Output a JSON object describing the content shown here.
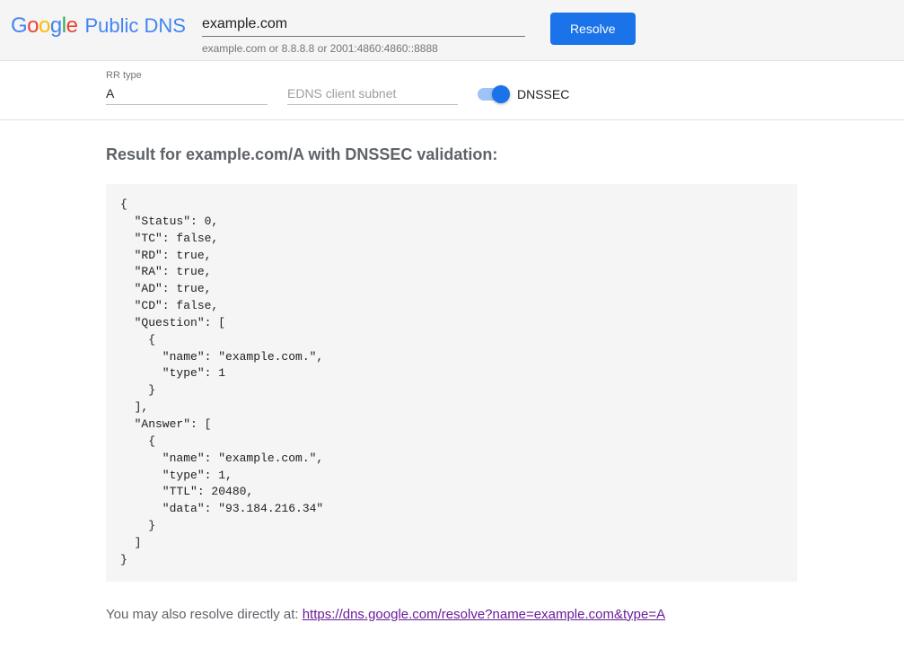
{
  "header": {
    "logo_text": "Google",
    "product_name": "Public DNS",
    "domain_value": "example.com",
    "hint": "example.com or 8.8.8.8 or 2001:4860:4860::8888",
    "resolve_label": "Resolve"
  },
  "options": {
    "rr_type_label": "RR type",
    "rr_type_value": "A",
    "edns_placeholder": "EDNS client subnet",
    "dnssec_label": "DNSSEC",
    "dnssec_on": true
  },
  "result": {
    "heading": "Result for example.com/A with DNSSEC validation:",
    "json_text": "{\n  \"Status\": 0,\n  \"TC\": false,\n  \"RD\": true,\n  \"RA\": true,\n  \"AD\": true,\n  \"CD\": false,\n  \"Question\": [\n    {\n      \"name\": \"example.com.\",\n      \"type\": 1\n    }\n  ],\n  \"Answer\": [\n    {\n      \"name\": \"example.com.\",\n      \"type\": 1,\n      \"TTL\": 20480,\n      \"data\": \"93.184.216.34\"\n    }\n  ]\n}"
  },
  "footer": {
    "lead": "You may also resolve directly at: ",
    "link_text": "https://dns.google.com/resolve?name=example.com&type=A"
  }
}
